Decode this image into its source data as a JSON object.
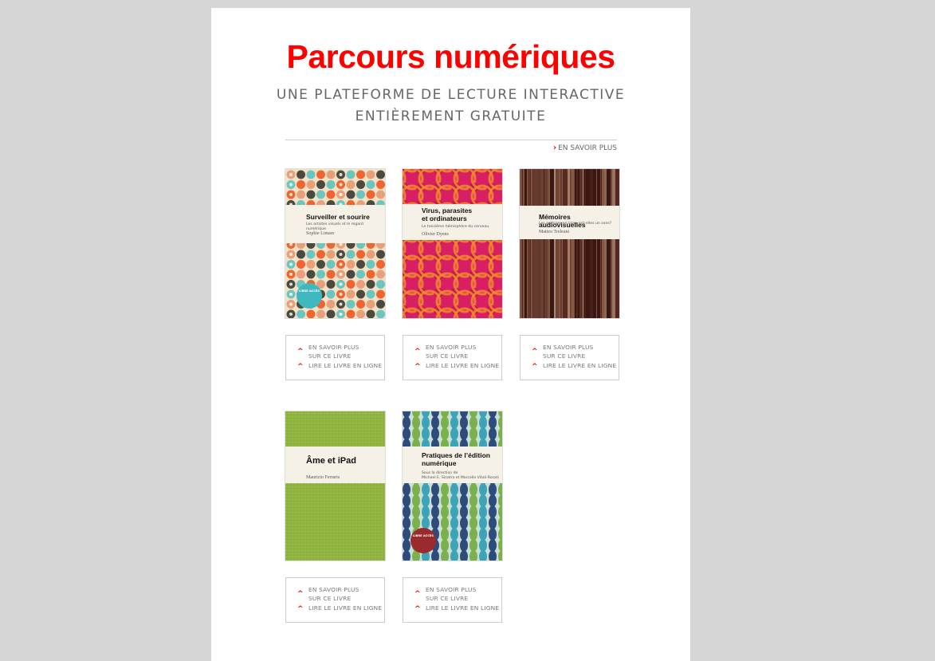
{
  "header": {
    "title": "Parcours numériques",
    "subtitle_line1": "UNE PLATEFORME DE LECTURE INTERACTIVE",
    "subtitle_line2": "ENTIÈREMENT GRATUITE",
    "more_link": "EN SAVOIR PLUS"
  },
  "book_links": {
    "more": "EN SAVOIR PLUS",
    "about_line1": "SUR CE LIVRE",
    "read_online": "LIRE LE LIVRE EN LIGNE"
  },
  "books": [
    {
      "title": "Surveiller et sourire",
      "subtitle": "Les artistes visuels et le regard numérique",
      "author": "Sophie Limare",
      "badge": "LIBRE ACCÈS",
      "pattern_colors": [
        "#f0652f",
        "#6cc6c0",
        "#4a4a3e",
        "#e8a07a",
        "#f4e2c8"
      ]
    },
    {
      "title": "Virus, parasites et ordinateurs",
      "subtitle": "Le troisième hémisphère du cerveau",
      "author": "Olivier Dyens",
      "pattern_colors": [
        "#d91f63",
        "#f08a2e",
        "#c81852"
      ]
    },
    {
      "title": "Mémoires audiovisuelles",
      "subtitle": "Les archives en ligne ont-elles un sens?",
      "author": "Matteo Treleani",
      "pattern_colors": [
        "#3a1812",
        "#8a5a46",
        "#c9a58f",
        "#5b2a20"
      ]
    },
    {
      "title": "Âme et iPad",
      "author": "Maurizio Ferraris",
      "pattern_colors": [
        "#8fb33f",
        "#a9c85a"
      ]
    },
    {
      "title": "Pratiques de l’édition numérique",
      "subtitle": "Sous la direction de",
      "author": "Michael E. Sinatra et Marcello Vitali-Rosati",
      "badge": "LIBRE ACCÈS",
      "pattern_colors": [
        "#2f4b7c",
        "#7cb04a",
        "#3fa3b8",
        "#c9e0d8"
      ]
    }
  ]
}
